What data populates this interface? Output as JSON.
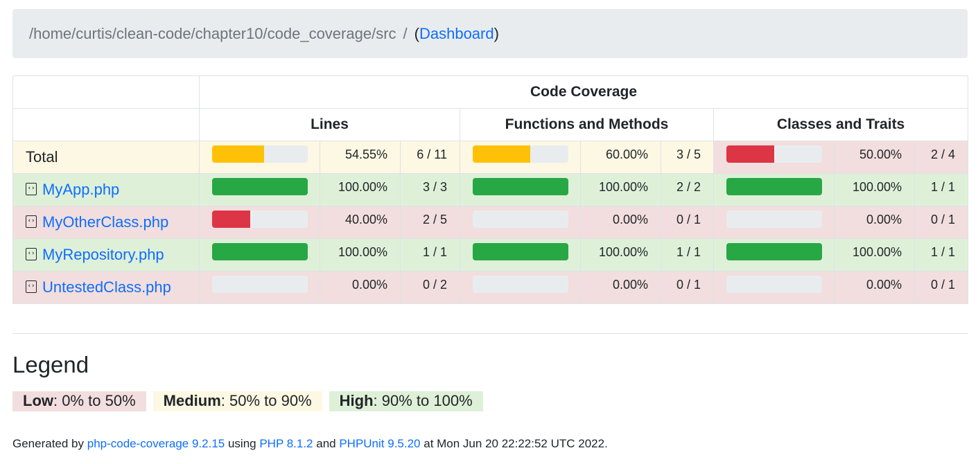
{
  "breadcrumb": {
    "path": "/home/curtis/clean-code/chapter10/code_coverage/src",
    "separator": "/",
    "open_paren": "(",
    "dashboard_label": "Dashboard",
    "close_paren": ")"
  },
  "table": {
    "header_main": "Code Coverage",
    "col_lines": "Lines",
    "col_functions": "Functions and Methods",
    "col_classes": "Classes and Traits",
    "rows": [
      {
        "name": "Total",
        "is_file": false,
        "level": "medium",
        "lines": {
          "pct": "54.55%",
          "ratio": "6 / 11",
          "value": 54.55,
          "level": "medium"
        },
        "functions": {
          "pct": "60.00%",
          "ratio": "3 / 5",
          "value": 60.0,
          "level": "medium"
        },
        "classes": {
          "pct": "50.00%",
          "ratio": "2 / 4",
          "value": 50.0,
          "level": "low"
        }
      },
      {
        "name": "MyApp.php",
        "is_file": true,
        "level": "high",
        "lines": {
          "pct": "100.00%",
          "ratio": "3 / 3",
          "value": 100,
          "level": "high"
        },
        "functions": {
          "pct": "100.00%",
          "ratio": "2 / 2",
          "value": 100,
          "level": "high"
        },
        "classes": {
          "pct": "100.00%",
          "ratio": "1 / 1",
          "value": 100,
          "level": "high"
        }
      },
      {
        "name": "MyOtherClass.php",
        "is_file": true,
        "level": "low",
        "lines": {
          "pct": "40.00%",
          "ratio": "2 / 5",
          "value": 40,
          "level": "low"
        },
        "functions": {
          "pct": "0.00%",
          "ratio": "0 / 1",
          "value": 0,
          "level": "low"
        },
        "classes": {
          "pct": "0.00%",
          "ratio": "0 / 1",
          "value": 0,
          "level": "low"
        }
      },
      {
        "name": "MyRepository.php",
        "is_file": true,
        "level": "high",
        "lines": {
          "pct": "100.00%",
          "ratio": "1 / 1",
          "value": 100,
          "level": "high"
        },
        "functions": {
          "pct": "100.00%",
          "ratio": "1 / 1",
          "value": 100,
          "level": "high"
        },
        "classes": {
          "pct": "100.00%",
          "ratio": "1 / 1",
          "value": 100,
          "level": "high"
        }
      },
      {
        "name": "UntestedClass.php",
        "is_file": true,
        "level": "low",
        "lines": {
          "pct": "0.00%",
          "ratio": "0 / 2",
          "value": 0,
          "level": "low"
        },
        "functions": {
          "pct": "0.00%",
          "ratio": "0 / 1",
          "value": 0,
          "level": "low"
        },
        "classes": {
          "pct": "0.00%",
          "ratio": "0 / 1",
          "value": 0,
          "level": "low"
        }
      }
    ]
  },
  "legend": {
    "title": "Legend",
    "low_label": "Low",
    "low_range": ": 0% to 50%",
    "medium_label": "Medium",
    "medium_range": ": 50% to 90%",
    "high_label": "High",
    "high_range": ": 90% to 100%"
  },
  "footer": {
    "generated_by": "Generated by ",
    "tool_link": "php-code-coverage 9.2.15",
    "using": " using ",
    "php_link": "PHP 8.1.2",
    "and": " and ",
    "phpunit_link": "PHPUnit 9.5.20",
    "at": " at Mon Jun 20 22:22:52 UTC 2022."
  },
  "colors": {
    "bar_low": "#dc3545",
    "bar_medium": "#ffc107",
    "bar_high": "#28a745",
    "bg_low": "#f2dede",
    "bg_medium": "#fcf8e3",
    "bg_high": "#dff0d8",
    "link": "#0d6efd"
  },
  "icons": {
    "file_icon": "file-code-icon"
  }
}
